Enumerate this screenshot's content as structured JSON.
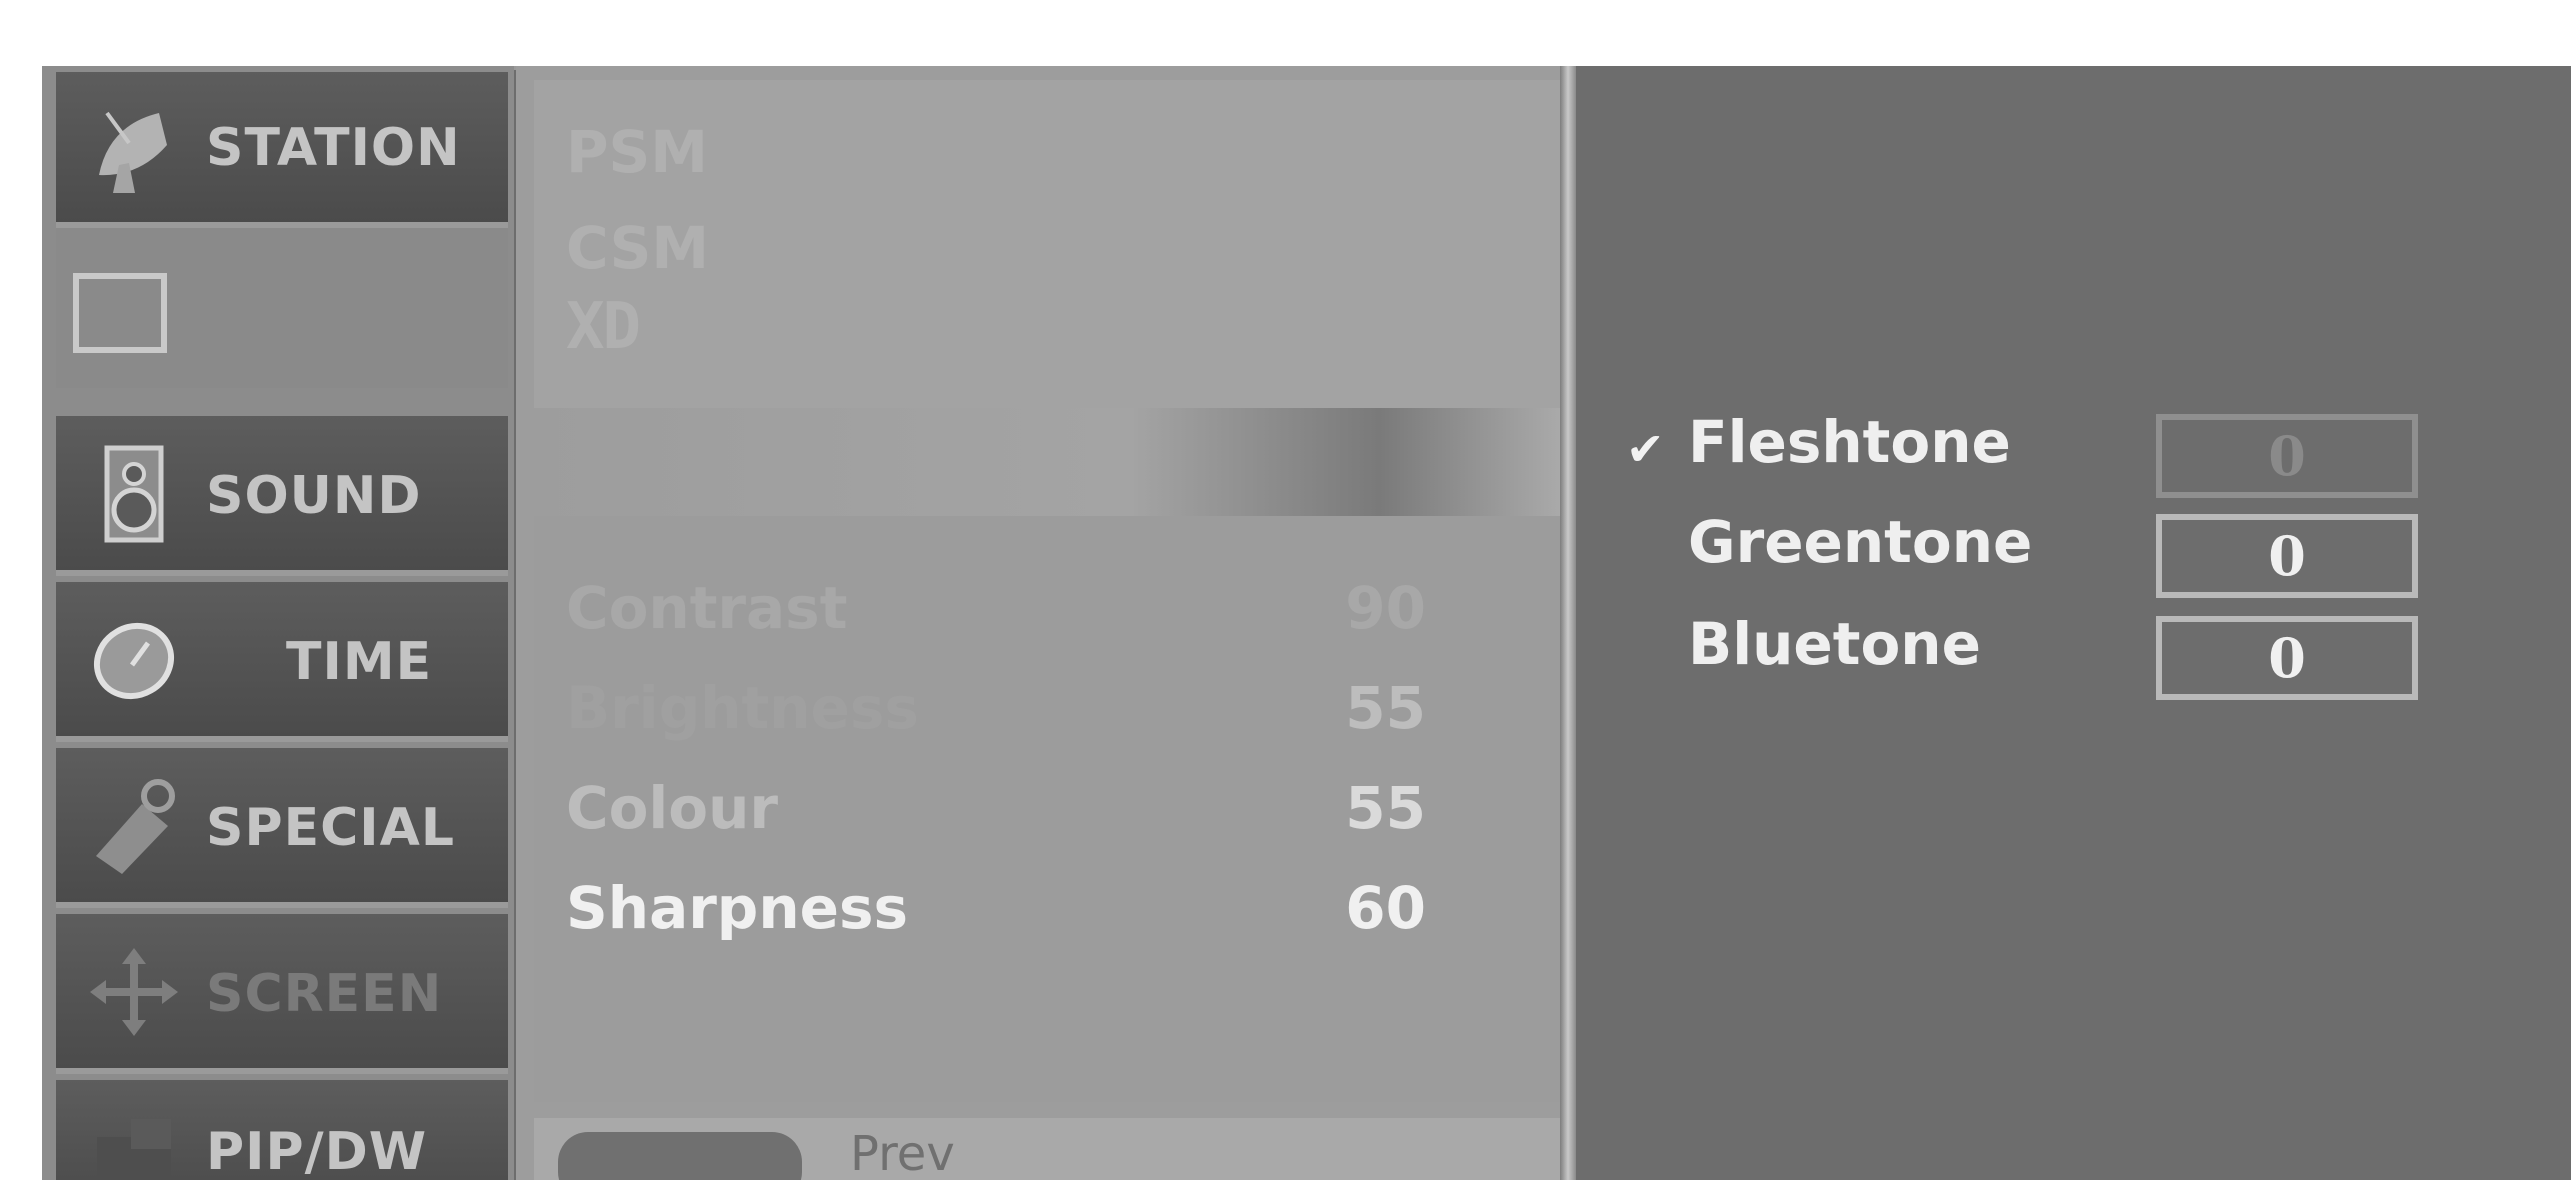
{
  "sidebar": {
    "items": [
      {
        "label": "STATION",
        "icon": "satellite-dish-icon"
      },
      {
        "label": "",
        "icon": "picture-monitor-icon"
      },
      {
        "label": "SOUND",
        "icon": "speaker-icon"
      },
      {
        "label": "TIME",
        "icon": "clock-icon"
      },
      {
        "label": "SPECIAL",
        "icon": "tag-icon"
      },
      {
        "label": "SCREEN",
        "icon": "arrows-move-icon"
      },
      {
        "label": "PIP/DW",
        "icon": "pip-icon"
      }
    ]
  },
  "picture_menu": {
    "modes": [
      "PSM",
      "CSM",
      "XD"
    ],
    "settings": [
      {
        "label": "Contrast",
        "value": "90"
      },
      {
        "label": "Brightness",
        "value": "55"
      },
      {
        "label": "Colour",
        "value": "55"
      },
      {
        "label": "Sharpness",
        "value": "60"
      }
    ],
    "prev_label": "Prev"
  },
  "tone_menu": {
    "items": [
      {
        "label": "Fleshtone",
        "value": "0",
        "checked": true
      },
      {
        "label": "Greentone",
        "value": "0",
        "checked": false
      },
      {
        "label": "Bluetone",
        "value": "0",
        "checked": false
      }
    ],
    "check_glyph": "✔"
  },
  "colors": {
    "panel_dark": "#6d6d6d",
    "panel_light": "#9d9d9d",
    "text_white": "#efefef"
  }
}
